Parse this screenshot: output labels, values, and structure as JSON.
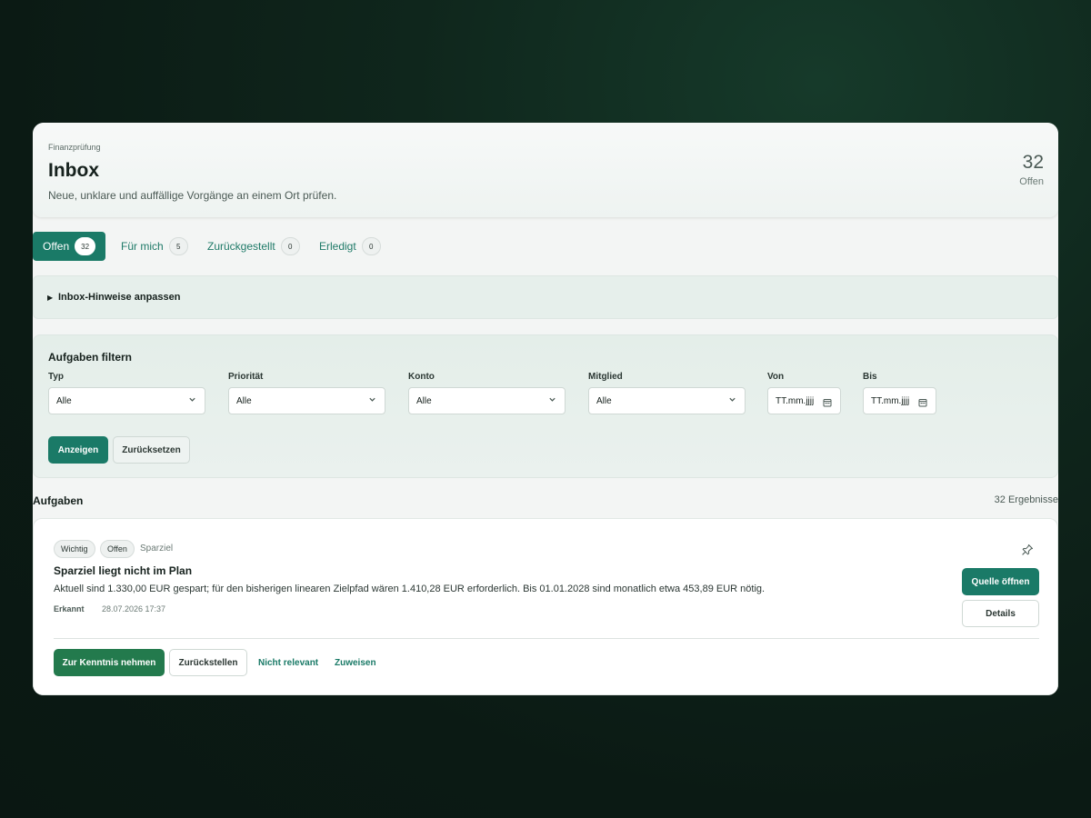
{
  "header": {
    "eyebrow": "Finanzprüfung",
    "title": "Inbox",
    "subtitle": "Neue, unklare und auffällige Vorgänge an einem Ort prüfen.",
    "open_count": "32",
    "open_label": "Offen"
  },
  "tabs": [
    {
      "label": "Offen",
      "count": "32",
      "active": true
    },
    {
      "label": "Für mich",
      "count": "5",
      "active": false
    },
    {
      "label": "Zurückgestellt",
      "count": "0",
      "active": false
    },
    {
      "label": "Erledigt",
      "count": "0",
      "active": false
    }
  ],
  "hints": {
    "caret": "▶",
    "label": "Inbox-Hinweise anpassen"
  },
  "filter": {
    "title": "Aufgaben filtern",
    "fields": [
      {
        "label": "Typ",
        "value": "Alle"
      },
      {
        "label": "Priorität",
        "value": "Alle"
      },
      {
        "label": "Konto",
        "value": "Alle"
      },
      {
        "label": "Mitglied",
        "value": "Alle"
      }
    ],
    "from": {
      "label": "Von",
      "value": "TT.mm.jjjj"
    },
    "to": {
      "label": "Bis",
      "value": "TT.mm.jjjj"
    },
    "chevron": "⌄",
    "show_label": "Anzeigen",
    "reset_label": "Zurücksetzen"
  },
  "tasks": {
    "title": "Aufgaben",
    "count_label": "32 Ergebnisse"
  },
  "card": {
    "badges": [
      "Wichtig",
      "Offen"
    ],
    "category": "Sparziel",
    "title": "Sparziel liegt nicht im Plan",
    "description": "Aktuell sind 1.330,00 EUR gespart; für den bisherigen linearen Zielpfad wären 1.410,28 EUR erforderlich. Bis 01.01.2028 sind monatlich etwa 453,89 EUR nötig.",
    "meta_label": "Erkannt",
    "meta_value": "28.07.2026 17:37",
    "source_label": "Quelle öffnen",
    "details_label": "Details",
    "ack_label": "Zur Kenntnis nehmen",
    "defer_label": "Zurückstellen",
    "not_relevant_label": "Nicht relevant",
    "assign_label": "Zuweisen"
  },
  "colors": {
    "accent": "#1a7a67",
    "ack_green": "#237a4d",
    "background": "#0f261c"
  }
}
